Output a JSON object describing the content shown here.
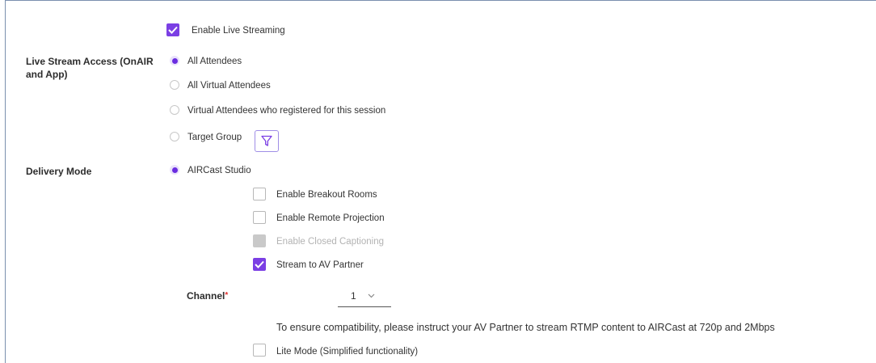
{
  "enable_live_streaming": {
    "label": "Enable Live Streaming",
    "checked": true
  },
  "live_stream_access": {
    "label": "Live Stream Access (OnAIR and App)",
    "options": [
      {
        "label": "All Attendees",
        "selected": true
      },
      {
        "label": "All Virtual Attendees",
        "selected": false
      },
      {
        "label": "Virtual Attendees who registered for this session",
        "selected": false
      },
      {
        "label": "Target Group",
        "selected": false
      }
    ],
    "filter_icon": "filter-icon"
  },
  "delivery_mode": {
    "label": "Delivery Mode",
    "option": {
      "label": "AIRCast Studio",
      "selected": true
    },
    "checkboxes": [
      {
        "label": "Enable Breakout Rooms",
        "checked": false,
        "disabled": false
      },
      {
        "label": "Enable Remote Projection",
        "checked": false,
        "disabled": false
      },
      {
        "label": "Enable Closed Captioning",
        "checked": false,
        "disabled": true
      },
      {
        "label": "Stream to AV Partner",
        "checked": true,
        "disabled": false
      }
    ]
  },
  "channel": {
    "label": "Channel",
    "required_marker": "*",
    "value": "1"
  },
  "notice": "To ensure compatibility, please instruct your AV Partner to stream RTMP content to AIRCast at 720p and 2Mbps",
  "lite_mode": {
    "label": "Lite Mode (Simplified functionality)",
    "checked": false
  },
  "colors": {
    "accent": "#7b3fe4",
    "radio_accent": "#6a2ce0",
    "required": "#e0312e"
  }
}
